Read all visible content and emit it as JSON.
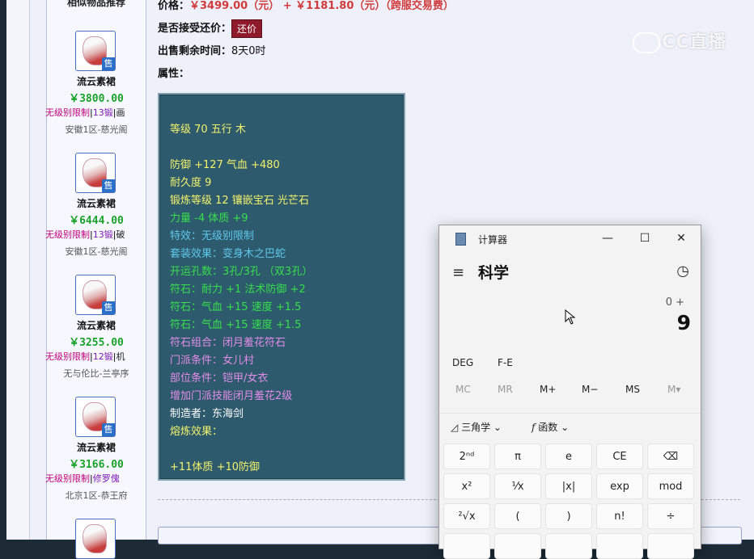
{
  "sidebar": {
    "title": "相似物品推荐",
    "items": [
      {
        "name": "流云素裙",
        "price": "￥3800.00",
        "tag1": "无级别限制",
        "tag2": "13锻",
        "tag3": "画",
        "server": "安徽1区-慈光阁"
      },
      {
        "name": "流云素裙",
        "price": "￥6444.00",
        "tag1": "无级别限制",
        "tag2": "13锻",
        "tag3": "破",
        "server": "安徽1区-慈光阁"
      },
      {
        "name": "流云素裙",
        "price": "￥3255.00",
        "tag1": "无级别限制",
        "tag2": "12锻",
        "tag3": "机",
        "server": "无与伦比-兰亭序"
      },
      {
        "name": "流云素裙",
        "price": "￥3166.00",
        "tag1": "无级别限制",
        "tag2": "修罗傀",
        "tag3": "",
        "server": "北京1区-恭王府"
      }
    ],
    "sold_badge": "售"
  },
  "main": {
    "price_label": "价格：",
    "price_value": "￥3499.00（元） +  ￥1181.80（元）（跨服交易费）",
    "bargain_label": "是否接受还价：",
    "bargain_button": "还价",
    "remaining_label": "出售剩余时间：",
    "remaining_value": "8天0时",
    "attr_label": "属性："
  },
  "attributes": [
    {
      "text": "等级 70 五行 木",
      "color": "y"
    },
    {
      "text": "防御 +127 气血 +480",
      "color": "y"
    },
    {
      "text": "耐久度 9",
      "color": "y"
    },
    {
      "text": "锻炼等级 12 镶嵌宝石 光芒石",
      "color": "y"
    },
    {
      "text": "力量 -4 体质 +9",
      "color": "g"
    },
    {
      "text": "特效：无级别限制",
      "color": "c"
    },
    {
      "text": "套装效果：变身木之巴蛇",
      "color": "c"
    },
    {
      "text": "开运孔数：3孔/3孔 （双3孔）",
      "color": "g"
    },
    {
      "text": "符石：耐力 +1 法术防御 +2",
      "color": "g"
    },
    {
      "text": "符石：气血 +15 速度 +1.5",
      "color": "g"
    },
    {
      "text": "符石：气血 +15 速度 +1.5",
      "color": "g"
    },
    {
      "text": "符石组合：闭月羞花符石",
      "color": "m"
    },
    {
      "text": "门派条件：女儿村",
      "color": "m"
    },
    {
      "text": "部位条件：铠甲/女衣",
      "color": "m"
    },
    {
      "text": "增加门派技能闭月羞花2级",
      "color": "m"
    },
    {
      "text": "制造者：东海剑",
      "color": "w"
    },
    {
      "text": "熔炼效果：",
      "color": "y"
    },
    {
      "text": "+11体质 +10防御",
      "color": "y"
    }
  ],
  "watermark": "CC直播",
  "calculator": {
    "window_title": "计算器",
    "minimize": "—",
    "maximize": "☐",
    "close": "✕",
    "menu_icon": "≡",
    "mode": "科学",
    "history_icon": "history-icon",
    "expression": "0 +",
    "display": "9",
    "deg": "DEG",
    "fe": "F-E",
    "memory": [
      "MC",
      "MR",
      "M+",
      "M−",
      "MS",
      "M▾"
    ],
    "trig_label": "三角学",
    "func_label": "函数",
    "keys_row1": [
      "2ⁿᵈ",
      "π",
      "e",
      "CE",
      "⌫"
    ],
    "keys_row2": [
      "x²",
      "¹⁄x",
      "|x|",
      "exp",
      "mod"
    ],
    "keys_row3": [
      "²√x",
      "(",
      ")",
      "n!",
      "÷"
    ]
  }
}
